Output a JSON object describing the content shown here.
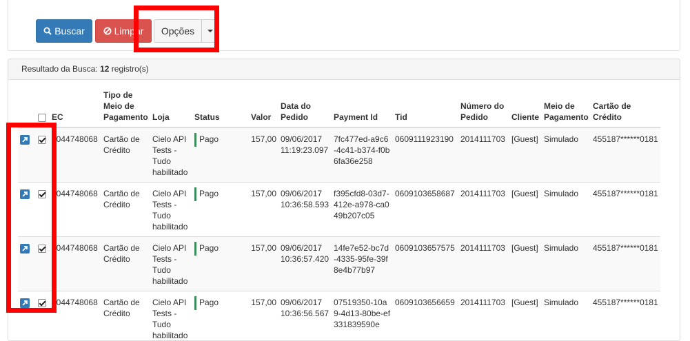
{
  "toolbar": {
    "buscar_label": "Buscar",
    "limpar_label": "Limpar",
    "opcoes_label": "Opções",
    "colors": {
      "primary": "#337ab7",
      "danger": "#d9534f",
      "default": "#f5f5f5"
    }
  },
  "result": {
    "heading_prefix": "Resultado da Busca: ",
    "count": "12",
    "count_suffix": " registro(s)"
  },
  "table": {
    "headers": {
      "ec": "EC",
      "tipo": "Tipo de Meio de Pagamento",
      "loja": "Loja",
      "status": "Status",
      "valor": "Valor",
      "data": "Data do Pedido",
      "payment_id": "Payment Id",
      "tid": "Tid",
      "numero": "Número do Pedido",
      "cliente": "Cliente",
      "meio": "Meio de Pagamento",
      "cartao": "Cartão de Crédito"
    },
    "rows": [
      {
        "ec": "0044748068",
        "tipo": "Cartão de Crédito",
        "loja": "Cielo API Tests - Tudo habilitado",
        "status": "Pago",
        "valor": "157,00",
        "data": "09/06/2017 11:19:23.097",
        "payment_id": "7fc477ed-a9c6-4c41-b374-f0b6fa36e258",
        "tid": "0609111923190",
        "numero": "2014111703",
        "cliente": "[Guest]",
        "meio": "Simulado",
        "cartao": "455187******0181"
      },
      {
        "ec": "0044748068",
        "tipo": "Cartão de Crédito",
        "loja": "Cielo API Tests - Tudo habilitado",
        "status": "Pago",
        "valor": "157,00",
        "data": "09/06/2017 10:36:58.593",
        "payment_id": "f395cfd8-03d7-412e-a978-ca049b207c05",
        "tid": "0609103658687",
        "numero": "2014111703",
        "cliente": "[Guest]",
        "meio": "Simulado",
        "cartao": "455187******0181"
      },
      {
        "ec": "0044748068",
        "tipo": "Cartão de Crédito",
        "loja": "Cielo API Tests - Tudo habilitado",
        "status": "Pago",
        "valor": "157,00",
        "data": "09/06/2017 10:36:57.420",
        "payment_id": "14fe7e52-bc7d-4335-95fe-39f8e4b77b97",
        "tid": "0609103657575",
        "numero": "2014111703",
        "cliente": "[Guest]",
        "meio": "Simulado",
        "cartao": "455187******0181"
      },
      {
        "ec": "0044748068",
        "tipo": "Cartão de Crédito",
        "loja": "Cielo API Tests - Tudo habilitado",
        "status": "Pago",
        "valor": "157,00",
        "data": "09/06/2017 10:36:56.567",
        "payment_id": "07519350-10a9-4d13-80be-ef331839590e",
        "tid": "0609103656659",
        "numero": "2014111703",
        "cliente": "[Guest]",
        "meio": "Simulado",
        "cartao": "455187******0181"
      }
    ]
  },
  "icons": {
    "search": "search-icon",
    "ban": "ban-icon",
    "caret": "caret-down-icon",
    "edit": "external-link-icon"
  },
  "annotation_color": "#ff0000"
}
